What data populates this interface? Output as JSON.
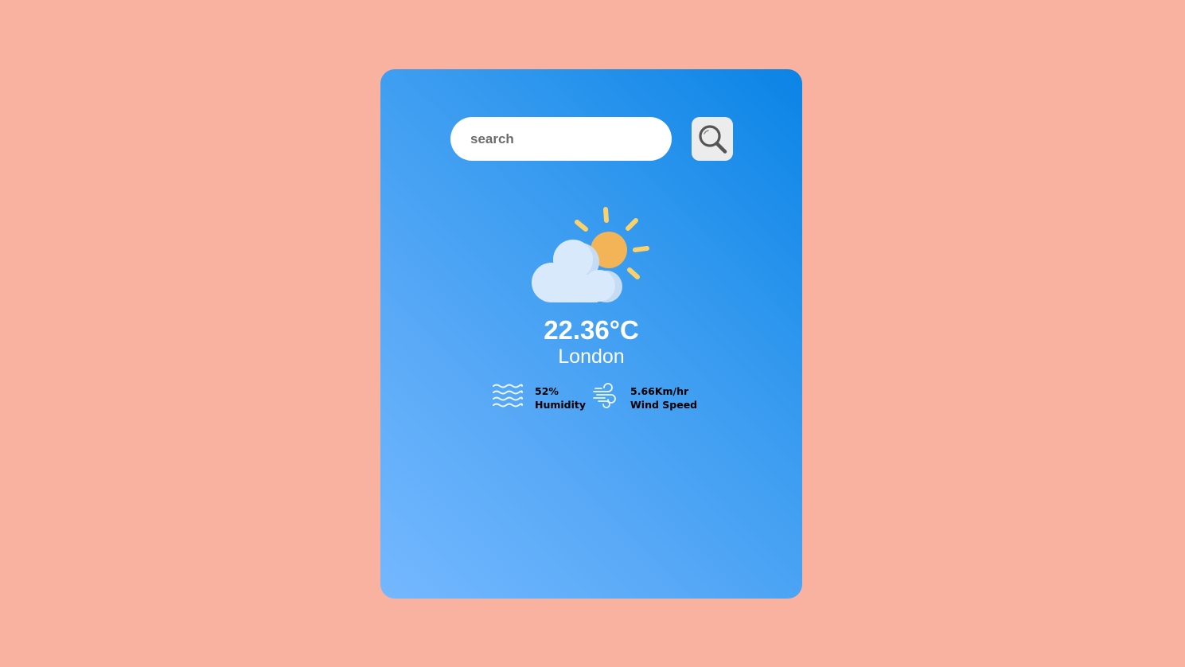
{
  "search": {
    "placeholder": "search",
    "button_icon": "search-icon"
  },
  "weather": {
    "icon": "partly-cloudy-icon",
    "temperature": "22.36°C",
    "city": "London"
  },
  "details": {
    "humidity": {
      "icon": "humidity-icon",
      "value": "52%",
      "label": "Humidity"
    },
    "wind": {
      "icon": "wind-icon",
      "value": "5.66Km/hr",
      "label": "Wind Speed"
    }
  },
  "colors": {
    "page_background": "#f9b2a0",
    "card_gradient_start": "#0a84e6",
    "card_gradient_end": "#74b8ff"
  }
}
